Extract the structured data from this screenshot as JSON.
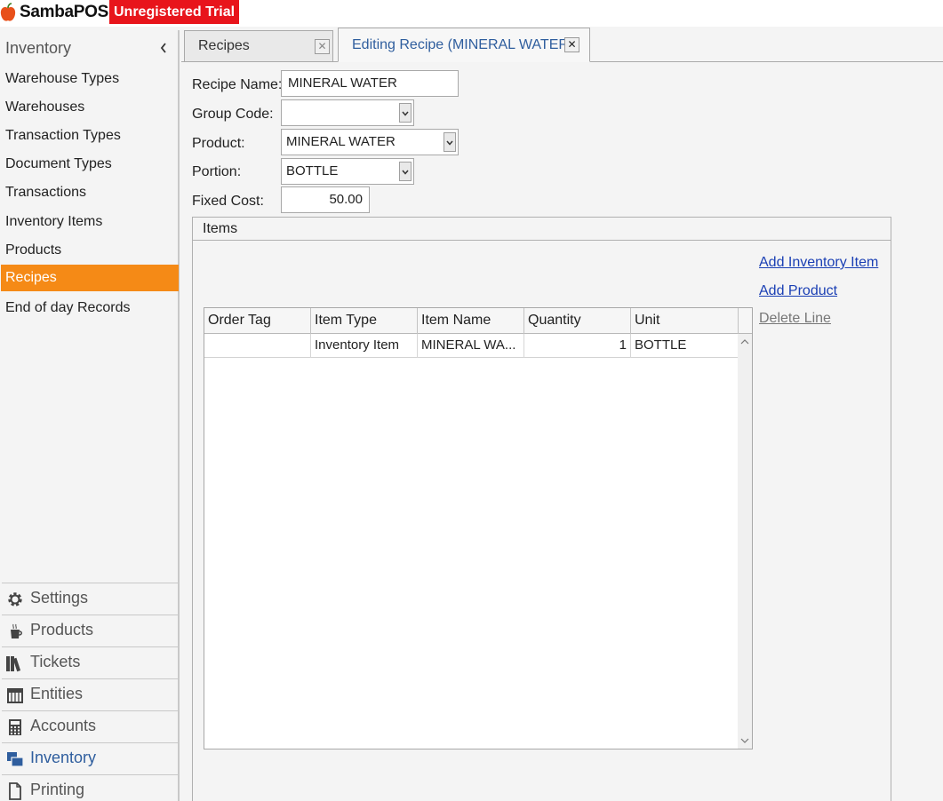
{
  "app": {
    "logo_text": "SambaPOS",
    "trial_badge": "Unregistered Trial",
    "colors": {
      "accent": "#f58a16",
      "trial": "#e8141b",
      "link": "#1a3fb4",
      "active_nav": "#2f5e9e"
    }
  },
  "sidebar": {
    "title": "Inventory",
    "collapse_icon": "chevron-left-icon",
    "items": [
      {
        "label": "Warehouse Types"
      },
      {
        "label": "Warehouses"
      },
      {
        "label": "Transaction Types"
      },
      {
        "label": "Document Types"
      },
      {
        "label": "Transactions"
      },
      {
        "label": "Inventory Items"
      },
      {
        "label": "Products"
      },
      {
        "label": "Recipes",
        "active": true
      },
      {
        "label": "End of day Records"
      }
    ],
    "bottom": [
      {
        "label": "Settings",
        "icon": "gear-icon"
      },
      {
        "label": "Products",
        "icon": "coffee-cup-icon"
      },
      {
        "label": "Tickets",
        "icon": "books-icon"
      },
      {
        "label": "Entities",
        "icon": "table-icon"
      },
      {
        "label": "Accounts",
        "icon": "calculator-icon"
      },
      {
        "label": "Inventory",
        "icon": "inventory-icon",
        "active": true
      },
      {
        "label": "Printing",
        "icon": "document-icon"
      }
    ]
  },
  "tabs": [
    {
      "label": "Recipes"
    },
    {
      "label": "Editing Recipe (MINERAL WATER)",
      "active": true
    }
  ],
  "form": {
    "recipe_name": {
      "label": "Recipe Name:",
      "value": "MINERAL WATER"
    },
    "group_code": {
      "label": "Group Code:",
      "value": ""
    },
    "product": {
      "label": "Product:",
      "value": "MINERAL WATER"
    },
    "portion": {
      "label": "Portion:",
      "value": "BOTTLE"
    },
    "fixed_cost": {
      "label": "Fixed Cost:",
      "value": "50.00"
    }
  },
  "items": {
    "title": "Items",
    "actions": {
      "add_inventory_item": "Add Inventory Item",
      "add_product": "Add Product",
      "delete_line": "Delete Line"
    },
    "columns": [
      "Order Tag",
      "Item Type",
      "Item Name",
      "Quantity",
      "Unit"
    ],
    "rows": [
      {
        "order_tag": "",
        "item_type": "Inventory Item",
        "item_name": "MINERAL WA...",
        "quantity": "1",
        "unit": "BOTTLE"
      }
    ]
  }
}
